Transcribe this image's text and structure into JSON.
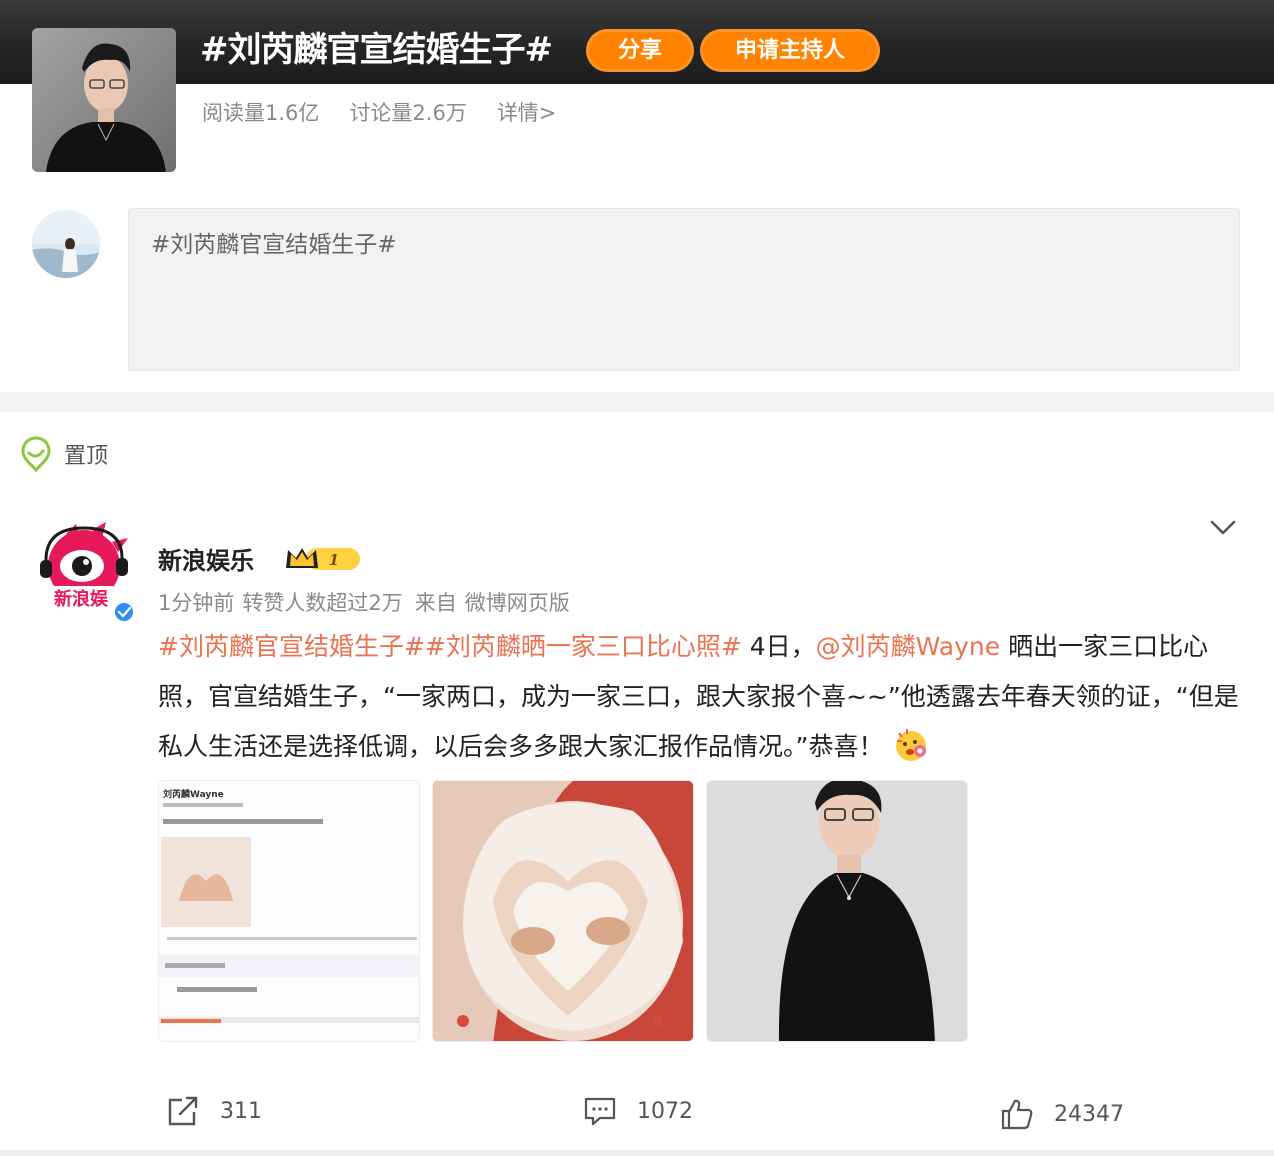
{
  "topic": {
    "title": "#刘芮麟官宣结婚生子#",
    "share_label": "分享",
    "apply_host_label": "申请主持人",
    "read_count": "阅读量1.6亿",
    "discuss_count": "讨论量2.6万",
    "details_link": "详情>"
  },
  "compose": {
    "text": "#刘芮麟官宣结婚生子#"
  },
  "pinned": {
    "label": "置顶"
  },
  "post": {
    "user_name": "新浪娱乐",
    "badge_level": "1",
    "time": "1分钟前",
    "repost_note": "转赞人数超过2万",
    "source_prefix": "来自",
    "source": "微博网页版",
    "tag1": "#刘芮麟官宣结婚生子#",
    "tag2": "#刘芮麟晒一家三口比心照#",
    "text_a": " 4日，",
    "mention": "@刘芮麟Wayne",
    "text_b": " 晒出一家三口比心照，官宣结婚生子，“一家两口，成为一家三口，跟大家报个喜~~”他透露去年春天领的证，“但是私人生活还是选择低调，以后会多多跟大家汇报作品情况。”恭喜！",
    "thumb_caption": "刘芮麟Wayne",
    "actions": {
      "repost_count": "311",
      "comment_count": "1072",
      "like_count": "24347"
    }
  },
  "colors": {
    "brand_orange": "#ff8200",
    "link_orange": "#eb7350",
    "header_dark": "#262626"
  },
  "icons": [
    "pin-icon",
    "vip-crown-icon",
    "verified-icon",
    "chevron-down-icon",
    "repost-icon",
    "comment-icon",
    "like-icon",
    "celebrate-emoji-icon"
  ]
}
